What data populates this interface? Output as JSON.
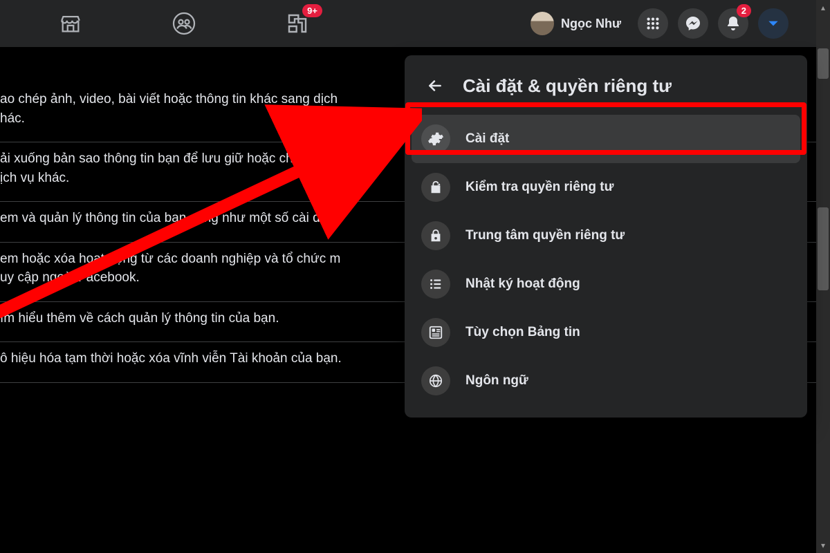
{
  "header": {
    "profile_name": "Ngọc Như",
    "gaming_badge": "9+",
    "notif_badge": "2"
  },
  "panel": {
    "title": "Cài đặt & quyền riêng tư",
    "items": [
      {
        "label": "Cài đặt"
      },
      {
        "label": "Kiểm tra quyền riêng tư"
      },
      {
        "label": "Trung tâm quyền riêng tư"
      },
      {
        "label": "Nhật ký hoạt động"
      },
      {
        "label": "Tùy chọn Bảng tin"
      },
      {
        "label": "Ngôn ngữ"
      }
    ]
  },
  "content": {
    "rows": [
      "ao chép ảnh, video, bài viết hoặc thông tin khác sang dịch\nhác.",
      "ải xuống bản sao thông tin     bạn để lưu giữ hoặc chuyể\nịch vụ khác.",
      "em và quản lý thông tin của bạn cũng như một số cài đặt.",
      "em hoặc xóa hoạt động từ các doanh nghiệp và tổ chức m\nuy cập ngoài Facebook.",
      "ìm hiểu thêm về cách quản lý thông tin của bạn.",
      "ô hiệu hóa tạm thời hoặc xóa vĩnh viễn Tài khoản của bạn."
    ],
    "link_label": "Xem"
  }
}
